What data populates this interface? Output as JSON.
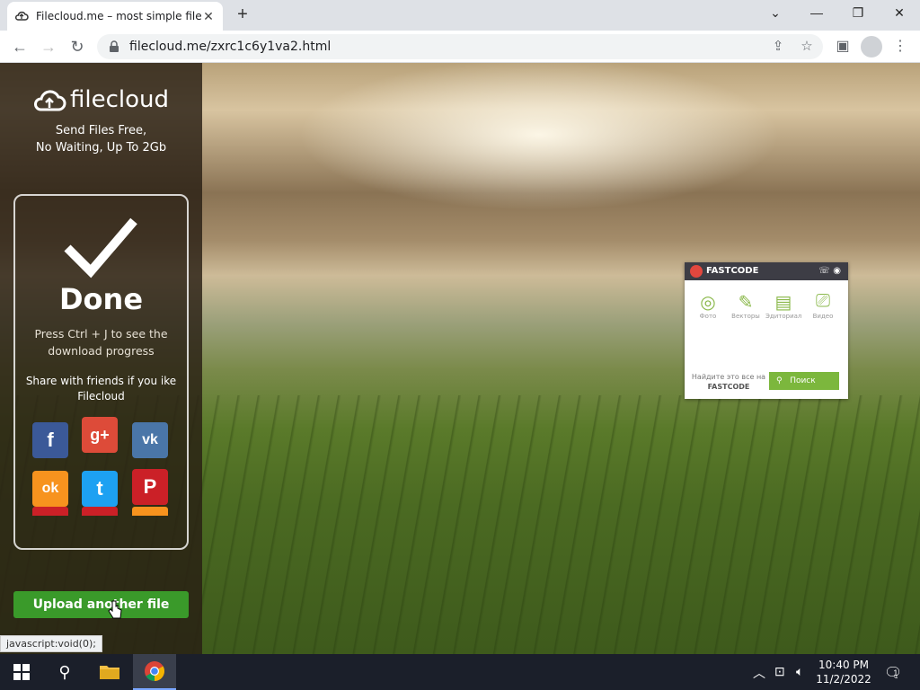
{
  "browser": {
    "tab_title": "Filecloud.me – most simple file s",
    "url": "filecloud.me/zxrc1c6y1va2.html"
  },
  "sidebar": {
    "logo_text": "filecloud",
    "tagline_1": "Send Files Free,",
    "tagline_2": "No Waiting, Up To 2Gb",
    "done_title": "Done",
    "hint": "Press Ctrl + J to see the download progress",
    "share_text": "Share with friends if you ike Filecloud",
    "social": [
      {
        "name": "facebook",
        "color": "#3b5998",
        "glyph": "f"
      },
      {
        "name": "google-plus",
        "color": "#dd4b39",
        "glyph": "g+"
      },
      {
        "name": "vk",
        "color": "#4a76a8",
        "glyph": "vk"
      },
      {
        "name": "odnoklassniki",
        "color": "#f7931e",
        "glyph": "ok"
      },
      {
        "name": "twitter",
        "color": "#1da1f2",
        "glyph": "t"
      },
      {
        "name": "pinterest",
        "color": "#cb2027",
        "glyph": "P"
      }
    ],
    "upload_button": "Upload another file"
  },
  "status_bar": "javascript:void(0);",
  "fastcode": {
    "brand": "FASTCODE",
    "items": [
      {
        "icon": "camera-icon",
        "label": "Фото"
      },
      {
        "icon": "vector-icon",
        "label": "Векторы"
      },
      {
        "icon": "editorial-icon",
        "label": "Эдиториал"
      },
      {
        "icon": "video-icon",
        "label": "Видео"
      }
    ],
    "find_text": "Найдите это все на",
    "find_brand": "FASTCODE",
    "search_label": "Поиск"
  },
  "taskbar": {
    "time": "10:40 PM",
    "date": "11/2/2022",
    "notifications": "1"
  }
}
